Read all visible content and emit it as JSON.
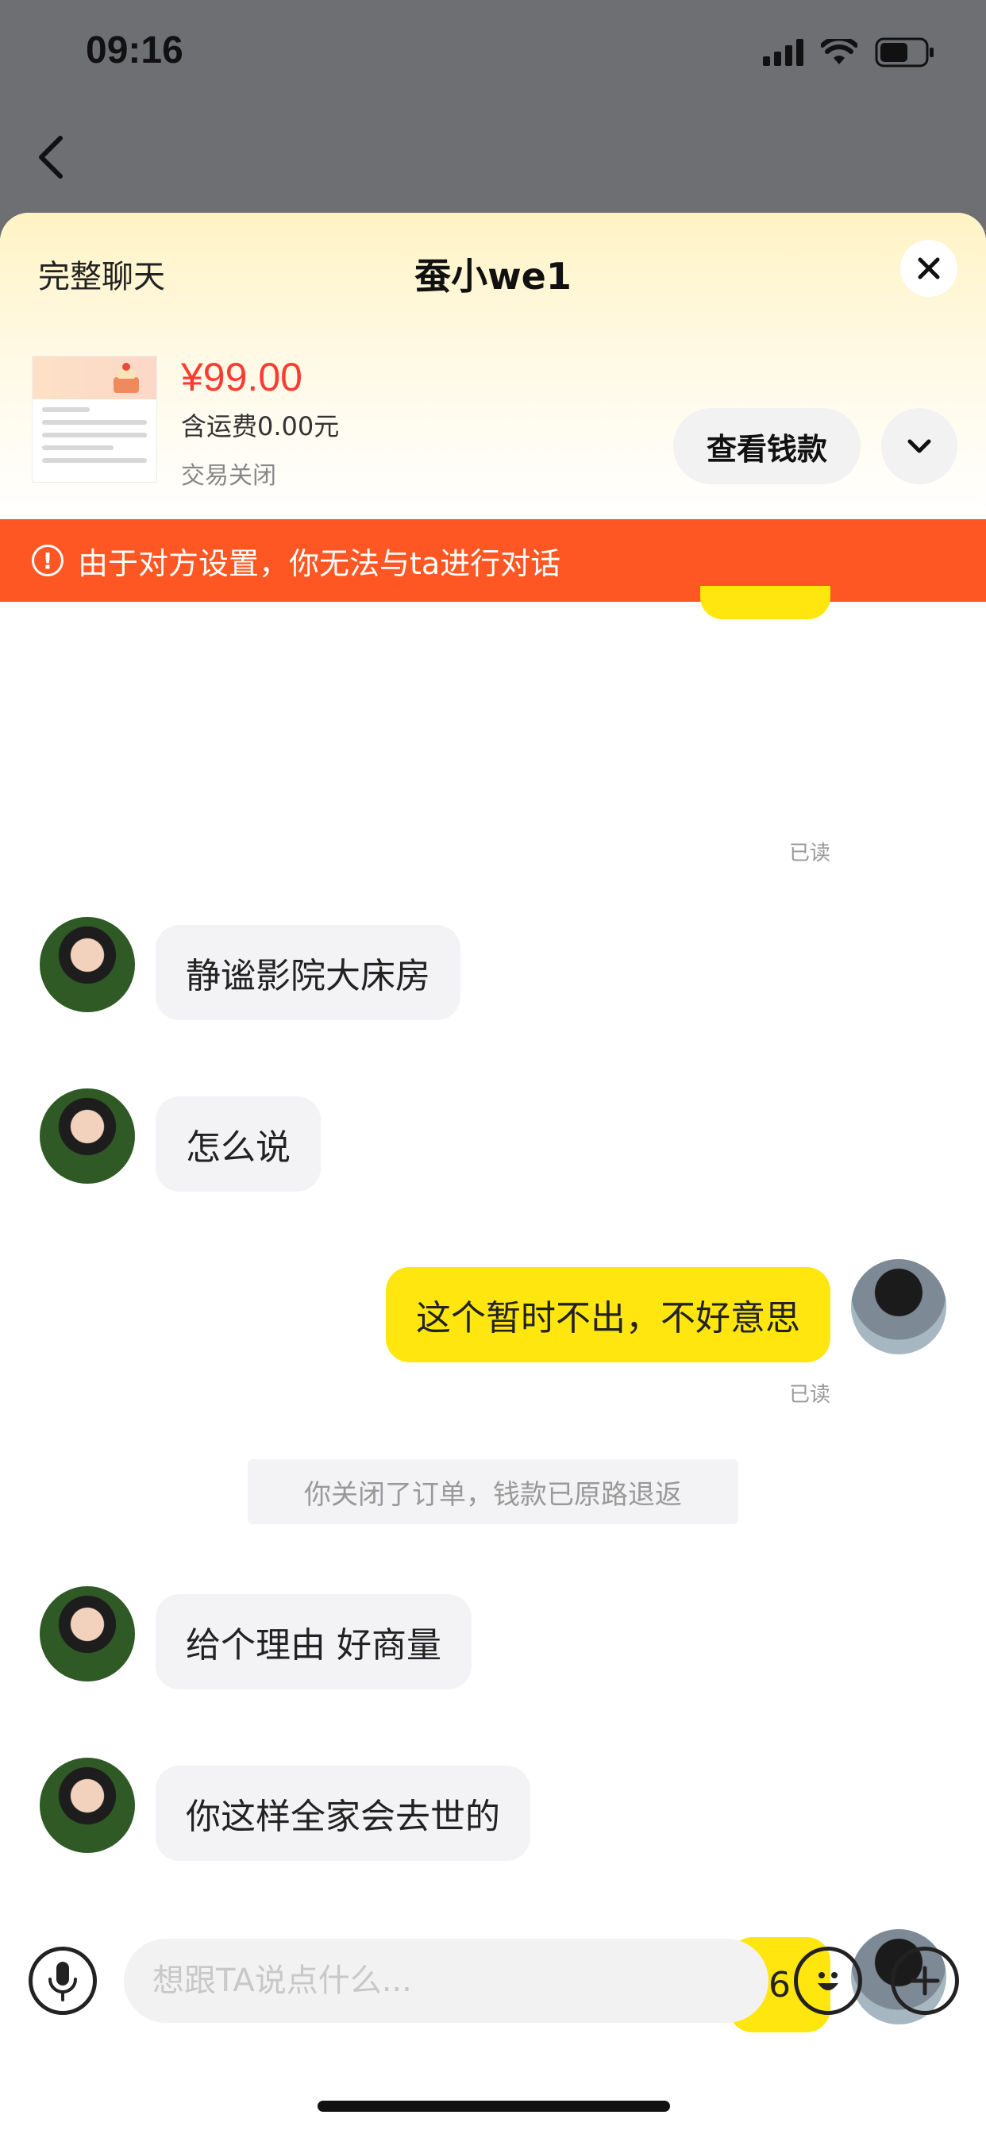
{
  "status_bar": {
    "time": "09:16"
  },
  "header": {
    "full_chat_label": "完整聊天",
    "title": "蚕小we1",
    "close_icon": "close-icon",
    "back_icon": "chevron-left-icon"
  },
  "product": {
    "price": "¥99.00",
    "shipping": "含运费0.00元",
    "status": "交易关闭",
    "view_button_label": "查看钱款",
    "expand_icon": "chevron-down-icon"
  },
  "warning": {
    "icon": "alert-circle-icon",
    "text": "由于对方设置，你无法与ta进行对话"
  },
  "messages": [
    {
      "side": "self",
      "text": "",
      "read_label": "已读"
    },
    {
      "side": "other",
      "text": "静谧影院大床房"
    },
    {
      "side": "other",
      "text": "怎么说"
    },
    {
      "side": "self",
      "text": "这个暂时不出，不好意思",
      "read_label": "已读"
    },
    {
      "side": "system",
      "text": "你关闭了订单，钱款已原路退返"
    },
    {
      "side": "other",
      "text": "给个理由 好商量"
    },
    {
      "side": "other",
      "text": "你这样全家会去世的"
    },
    {
      "side": "self",
      "text": "6",
      "failed": true
    }
  ],
  "input_bar": {
    "placeholder": "想跟TA说点什么...",
    "value": "",
    "mic_icon": "microphone-icon",
    "emoji_icon": "emoji-icon",
    "plus_icon": "plus-icon"
  },
  "colors": {
    "accent_yellow": "#ffe60f",
    "warning_orange": "#ff5724",
    "price_red": "#ff3b30",
    "error_red": "#f33b3b"
  }
}
